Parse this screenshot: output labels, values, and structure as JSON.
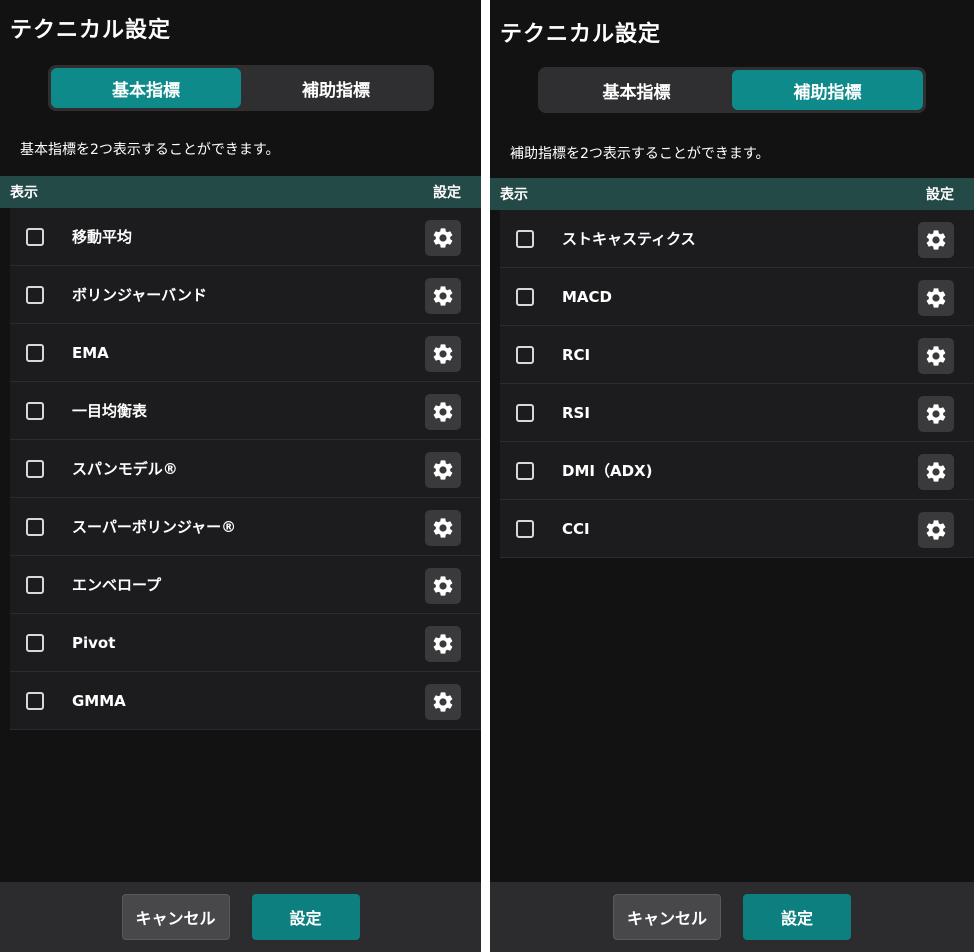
{
  "left": {
    "title": "テクニカル設定",
    "tabs": [
      {
        "label": "基本指標",
        "active": true
      },
      {
        "label": "補助指標",
        "active": false
      }
    ],
    "description": "基本指標を2つ表示することができます。",
    "header": {
      "show": "表示",
      "settings": "設定"
    },
    "items": [
      {
        "label": "移動平均"
      },
      {
        "label": "ボリンジャーバンド"
      },
      {
        "label": "EMA"
      },
      {
        "label": "一目均衡表"
      },
      {
        "label": "スパンモデル®"
      },
      {
        "label": "スーパーボリンジャー®"
      },
      {
        "label": "エンベロープ"
      },
      {
        "label": "Pivot"
      },
      {
        "label": "GMMA"
      }
    ],
    "footer": {
      "cancel": "キャンセル",
      "ok": "設定"
    }
  },
  "right": {
    "title": "テクニカル設定",
    "tabs": [
      {
        "label": "基本指標",
        "active": false
      },
      {
        "label": "補助指標",
        "active": true
      }
    ],
    "description": "補助指標を2つ表示することができます。",
    "header": {
      "show": "表示",
      "settings": "設定"
    },
    "items": [
      {
        "label": "ストキャスティクス"
      },
      {
        "label": "MACD"
      },
      {
        "label": "RCI"
      },
      {
        "label": "RSI"
      },
      {
        "label": "DMI（ADX)"
      },
      {
        "label": "CCI"
      }
    ],
    "footer": {
      "cancel": "キャンセル",
      "ok": "設定"
    }
  },
  "icons": {
    "settings": "gear-icon",
    "checkbox": "checkbox-unchecked"
  },
  "colors": {
    "accent": "#0e8a8a",
    "header_bg": "#244a48",
    "background": "#121212"
  }
}
